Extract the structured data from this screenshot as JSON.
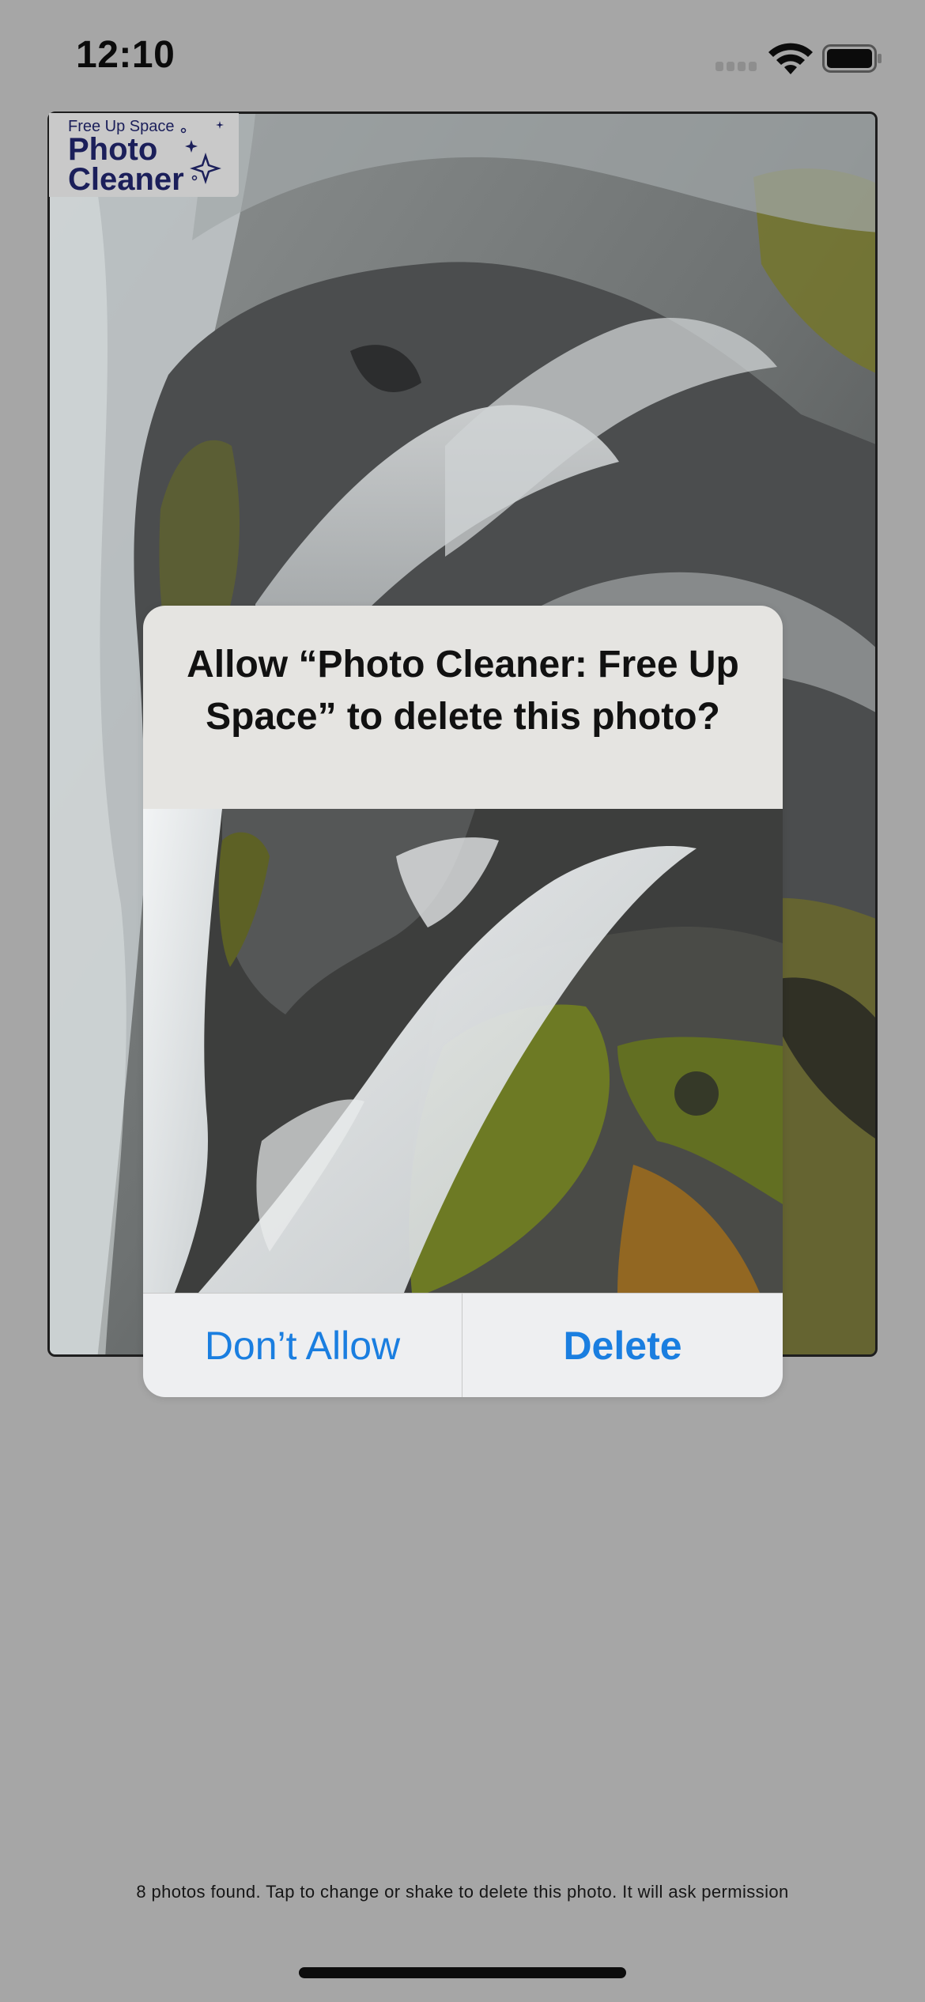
{
  "status_bar": {
    "time": "12:10"
  },
  "logo": {
    "tagline": "Free Up Space",
    "line1": "Photo",
    "line2": "Cleaner"
  },
  "alert": {
    "title": "Allow “Photo Cleaner: Free Up Space” to delete this photo?",
    "dont_allow_label": "Don’t Allow",
    "delete_label": "Delete"
  },
  "footer": {
    "hint": "8 photos found. Tap to change or shake to delete this photo. It will ask permission"
  },
  "colors": {
    "background": "#a6a6a6",
    "accent": "#1a7ee0",
    "logo_ink": "#1b1f5a"
  }
}
